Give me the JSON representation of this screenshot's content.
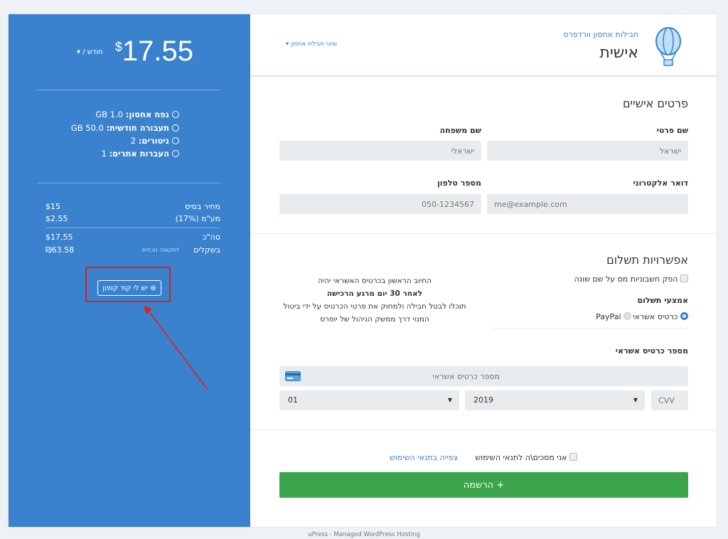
{
  "sidebar": {
    "currency": "$",
    "price": "17.55",
    "period": "/ חודש",
    "period_caret": "▾",
    "features": [
      {
        "label": "נפח אחסון:",
        "value": "1.0 GB"
      },
      {
        "label": "תעבורה חודשית:",
        "value": "50.0 GB"
      },
      {
        "label": "ניטורים:",
        "value": "2"
      },
      {
        "label": "העברות אתרים:",
        "value": "1"
      }
    ],
    "base_price_label": "מחיר בסיס",
    "base_price_value": "$15",
    "vat_label": "מע\"מ (17%)",
    "vat_value": "$2.55",
    "total_label": "סה\"כ",
    "total_value": "$17.55",
    "shekel_label": "בשקלים",
    "shekel_note": "לתקופה נוכחית",
    "shekel_value": "₪63.58",
    "coupon_label": "יש לי קוד קופון",
    "coupon_icon": "⊕"
  },
  "header": {
    "subtitle": "חבילות אחסון וורדפרס",
    "title": "אישית",
    "change_link": "שינוי חבילת אחסון"
  },
  "personal": {
    "heading": "פרטים אישיים",
    "first_name_label": "שם פרטי",
    "first_name_placeholder": "ישראל",
    "last_name_label": "שם משפחה",
    "last_name_placeholder": "ישראלי",
    "email_label": "דואר אלקטרוני",
    "email_placeholder": "me@example.com",
    "phone_label": "מספר טלפון",
    "phone_placeholder": "050-1234567"
  },
  "payment": {
    "heading": "אפשרויות תשלום",
    "invoice_label": "הפק חשבוניות מס על שם שונה",
    "method_label": "אמצעי תשלום",
    "credit_label": "כרטיס אשראי",
    "paypal_label": "PayPal",
    "notice_line1": "החיוב הראשון בכרטיס האשראי יהיה",
    "notice_line2": "לאחר 30 יום מרגע הרכישה",
    "notice_line3": "תוכלו לבטל חבילה ולמחוק את פרטי הכרטיס על ידי ביטול",
    "notice_line4": "המנוי דרך ממשק הניהול של יופרס",
    "card_label": "מספר כרטיס אשראי",
    "card_placeholder": "מספר כרטיס אשראי",
    "month_value": "01",
    "year_value": "2019",
    "cvv_placeholder": "CVV"
  },
  "terms": {
    "agree_label": "אני מסכים\\ה לתנאי השימוש",
    "view_link": "צפייה בתנאי השימוש"
  },
  "submit_label": "+ הרשמה",
  "footer": "uPress - Managed WordPress Hosting",
  "colors": {
    "sidebar": "#3a82cd",
    "submit": "#3aa54a",
    "highlight": "#e02020"
  }
}
